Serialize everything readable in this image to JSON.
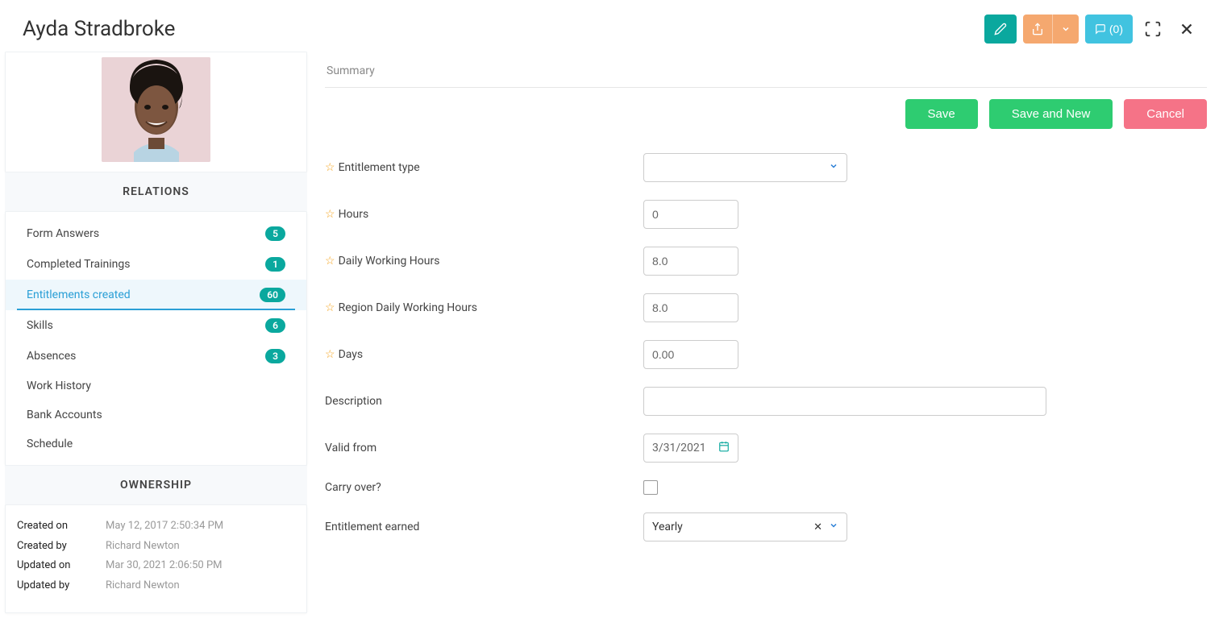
{
  "header": {
    "title": "Ayda Stradbroke",
    "comments_label": "(0)"
  },
  "sidebar": {
    "relations_title": "RELATIONS",
    "items": [
      {
        "label": "Form Answers",
        "badge": "5"
      },
      {
        "label": "Completed Trainings",
        "badge": "1"
      },
      {
        "label": "Entitlements created",
        "badge": "60"
      },
      {
        "label": "Skills",
        "badge": "6"
      },
      {
        "label": "Absences",
        "badge": "3"
      },
      {
        "label": "Work History",
        "badge": null
      },
      {
        "label": "Bank Accounts",
        "badge": null
      },
      {
        "label": "Schedule",
        "badge": null
      }
    ],
    "ownership_title": "OWNERSHIP",
    "ownership": {
      "created_on_label": "Created on",
      "created_on": "May 12, 2017 2:50:34 PM",
      "created_by_label": "Created by",
      "created_by": "Richard Newton",
      "updated_on_label": "Updated on",
      "updated_on": "Mar 30, 2021 2:06:50 PM",
      "updated_by_label": "Updated by",
      "updated_by": "Richard Newton"
    }
  },
  "main": {
    "tab": "Summary",
    "actions": {
      "save": "Save",
      "save_new": "Save and New",
      "cancel": "Cancel"
    },
    "fields": {
      "entitlement_type": {
        "label": "Entitlement type",
        "required": true,
        "value": ""
      },
      "hours": {
        "label": "Hours",
        "required": true,
        "value": "0"
      },
      "daily_hours": {
        "label": "Daily Working Hours",
        "required": true,
        "value": "8.0"
      },
      "region_daily": {
        "label": "Region Daily Working Hours",
        "required": true,
        "value": "8.0"
      },
      "days": {
        "label": "Days",
        "required": true,
        "value": "0.00"
      },
      "description": {
        "label": "Description",
        "required": false,
        "value": ""
      },
      "valid_from": {
        "label": "Valid from",
        "required": false,
        "value": "3/31/2021"
      },
      "carry_over": {
        "label": "Carry over?",
        "required": false,
        "checked": false
      },
      "entitlement_earned": {
        "label": "Entitlement earned",
        "required": false,
        "value": "Yearly"
      }
    }
  }
}
